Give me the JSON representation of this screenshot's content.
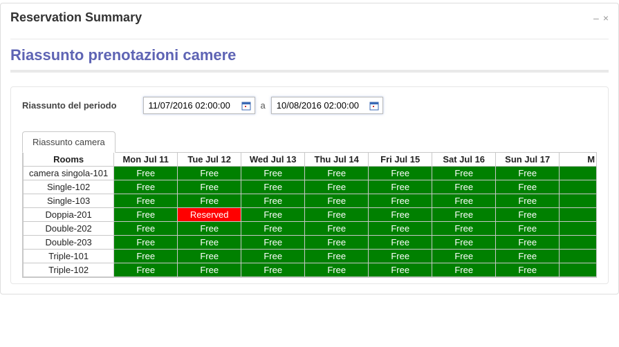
{
  "window": {
    "title": "Reservation Summary",
    "minimize": "–",
    "close": "×"
  },
  "subtitle": "Riassunto prenotazioni camere",
  "period": {
    "label": "Riassunto del periodo",
    "from": "11/07/2016 02:00:00",
    "sep": "a",
    "to": "10/08/2016 02:00:00"
  },
  "tab": {
    "label": "Riassunto camera"
  },
  "grid": {
    "roomsHeader": "Rooms",
    "partialHeader": "M",
    "columns": [
      "Mon Jul 11",
      "Tue Jul 12",
      "Wed Jul 13",
      "Thu Jul 14",
      "Fri Jul 15",
      "Sat Jul 16",
      "Sun Jul 17"
    ],
    "status": {
      "free": "Free",
      "reserved": "Reserved"
    },
    "rows": [
      {
        "room": "camera singola-101",
        "wrap": true,
        "cells": [
          "free",
          "free",
          "free",
          "free",
          "free",
          "free",
          "free"
        ]
      },
      {
        "room": "Single-102",
        "wrap": false,
        "cells": [
          "free",
          "free",
          "free",
          "free",
          "free",
          "free",
          "free"
        ]
      },
      {
        "room": "Single-103",
        "wrap": false,
        "cells": [
          "free",
          "free",
          "free",
          "free",
          "free",
          "free",
          "free"
        ]
      },
      {
        "room": "Doppia-201",
        "wrap": false,
        "cells": [
          "free",
          "reserved",
          "free",
          "free",
          "free",
          "free",
          "free"
        ]
      },
      {
        "room": "Double-202",
        "wrap": false,
        "cells": [
          "free",
          "free",
          "free",
          "free",
          "free",
          "free",
          "free"
        ]
      },
      {
        "room": "Double-203",
        "wrap": false,
        "cells": [
          "free",
          "free",
          "free",
          "free",
          "free",
          "free",
          "free"
        ]
      },
      {
        "room": "Triple-101",
        "wrap": false,
        "cells": [
          "free",
          "free",
          "free",
          "free",
          "free",
          "free",
          "free"
        ]
      },
      {
        "room": "Triple-102",
        "wrap": false,
        "cells": [
          "free",
          "free",
          "free",
          "free",
          "free",
          "free",
          "free"
        ]
      }
    ]
  }
}
